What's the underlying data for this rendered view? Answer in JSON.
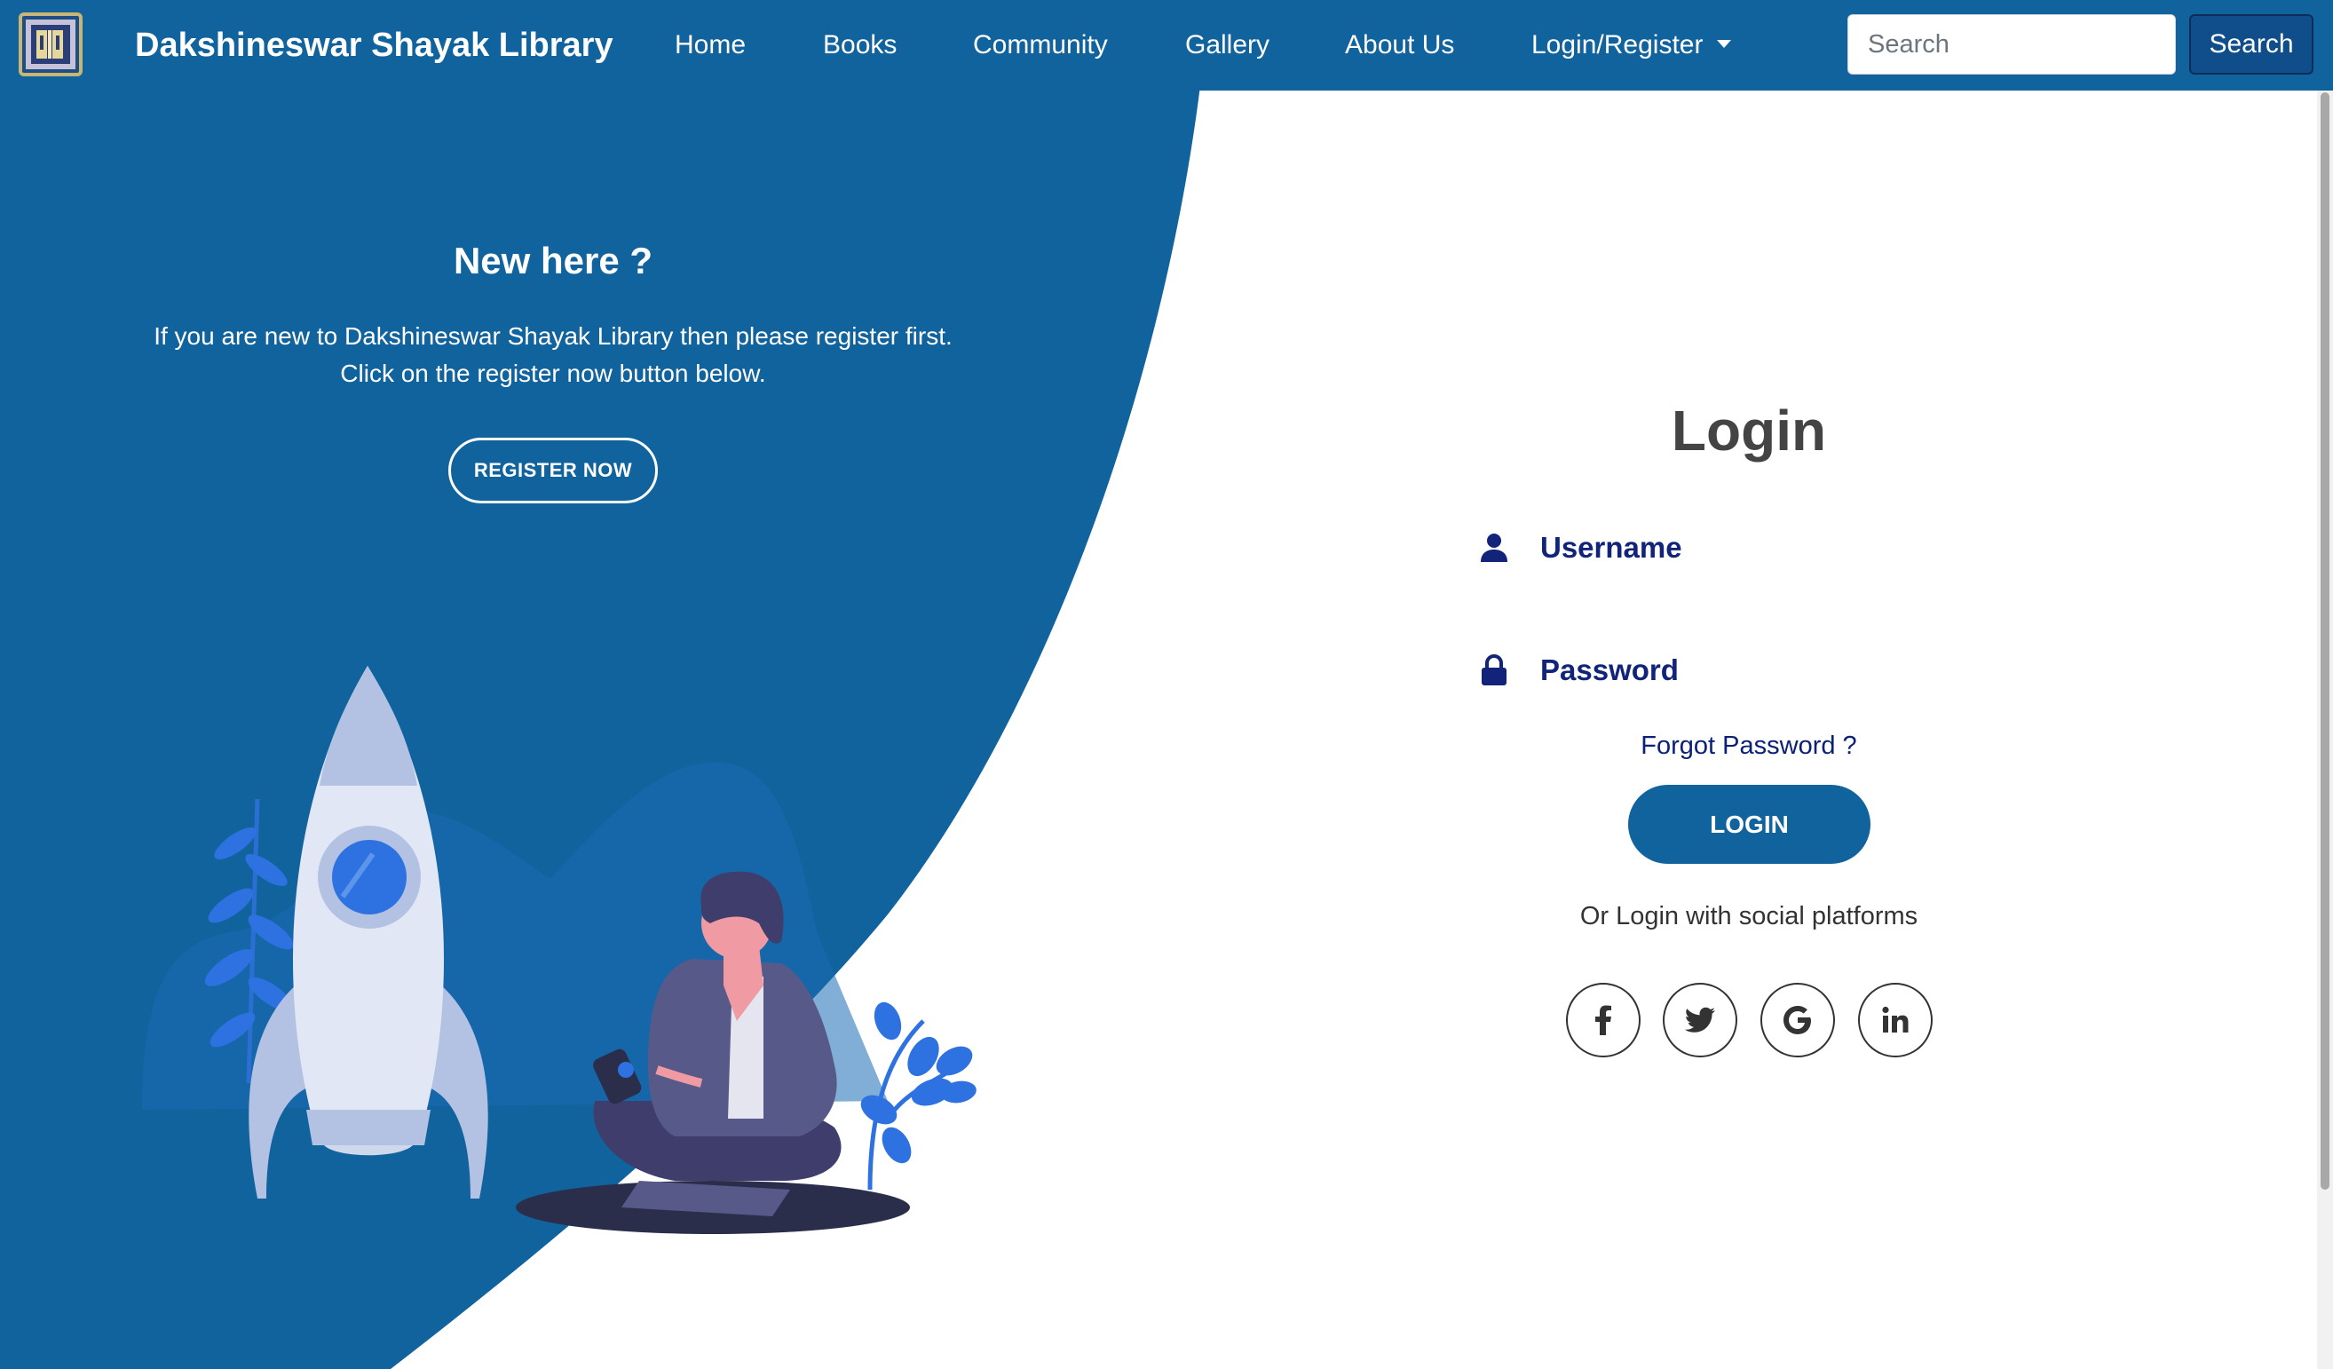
{
  "navbar": {
    "brand": "Dakshineswar Shayak Library",
    "links": [
      {
        "label": "Home"
      },
      {
        "label": "Books"
      },
      {
        "label": "Community"
      },
      {
        "label": "Gallery"
      },
      {
        "label": "About Us"
      },
      {
        "label": "Login/Register"
      }
    ],
    "search": {
      "placeholder": "Search",
      "value": "",
      "button_label": "Search"
    }
  },
  "left_panel": {
    "title": "New here ?",
    "text_line1": "If you are new to Dakshineswar Shayak Library then please register first.",
    "text_line2": "Click on the register now button below.",
    "register_button": "REGISTER NOW"
  },
  "login": {
    "title": "Login",
    "username_placeholder": "Username",
    "password_placeholder": "Password",
    "forgot_password": "Forgot Password ?",
    "login_button": "LOGIN",
    "social_text": "Or Login with social platforms",
    "social": [
      {
        "icon": "facebook-icon",
        "glyph": "f"
      },
      {
        "icon": "twitter-icon",
        "glyph": "🐦"
      },
      {
        "icon": "google-icon",
        "glyph": "G"
      },
      {
        "icon": "linkedin-icon",
        "glyph": "in"
      }
    ]
  },
  "colors": {
    "primary": "#11639e",
    "text_dark": "#444444",
    "field_text": "#0d1f6b",
    "white": "#ffffff"
  }
}
